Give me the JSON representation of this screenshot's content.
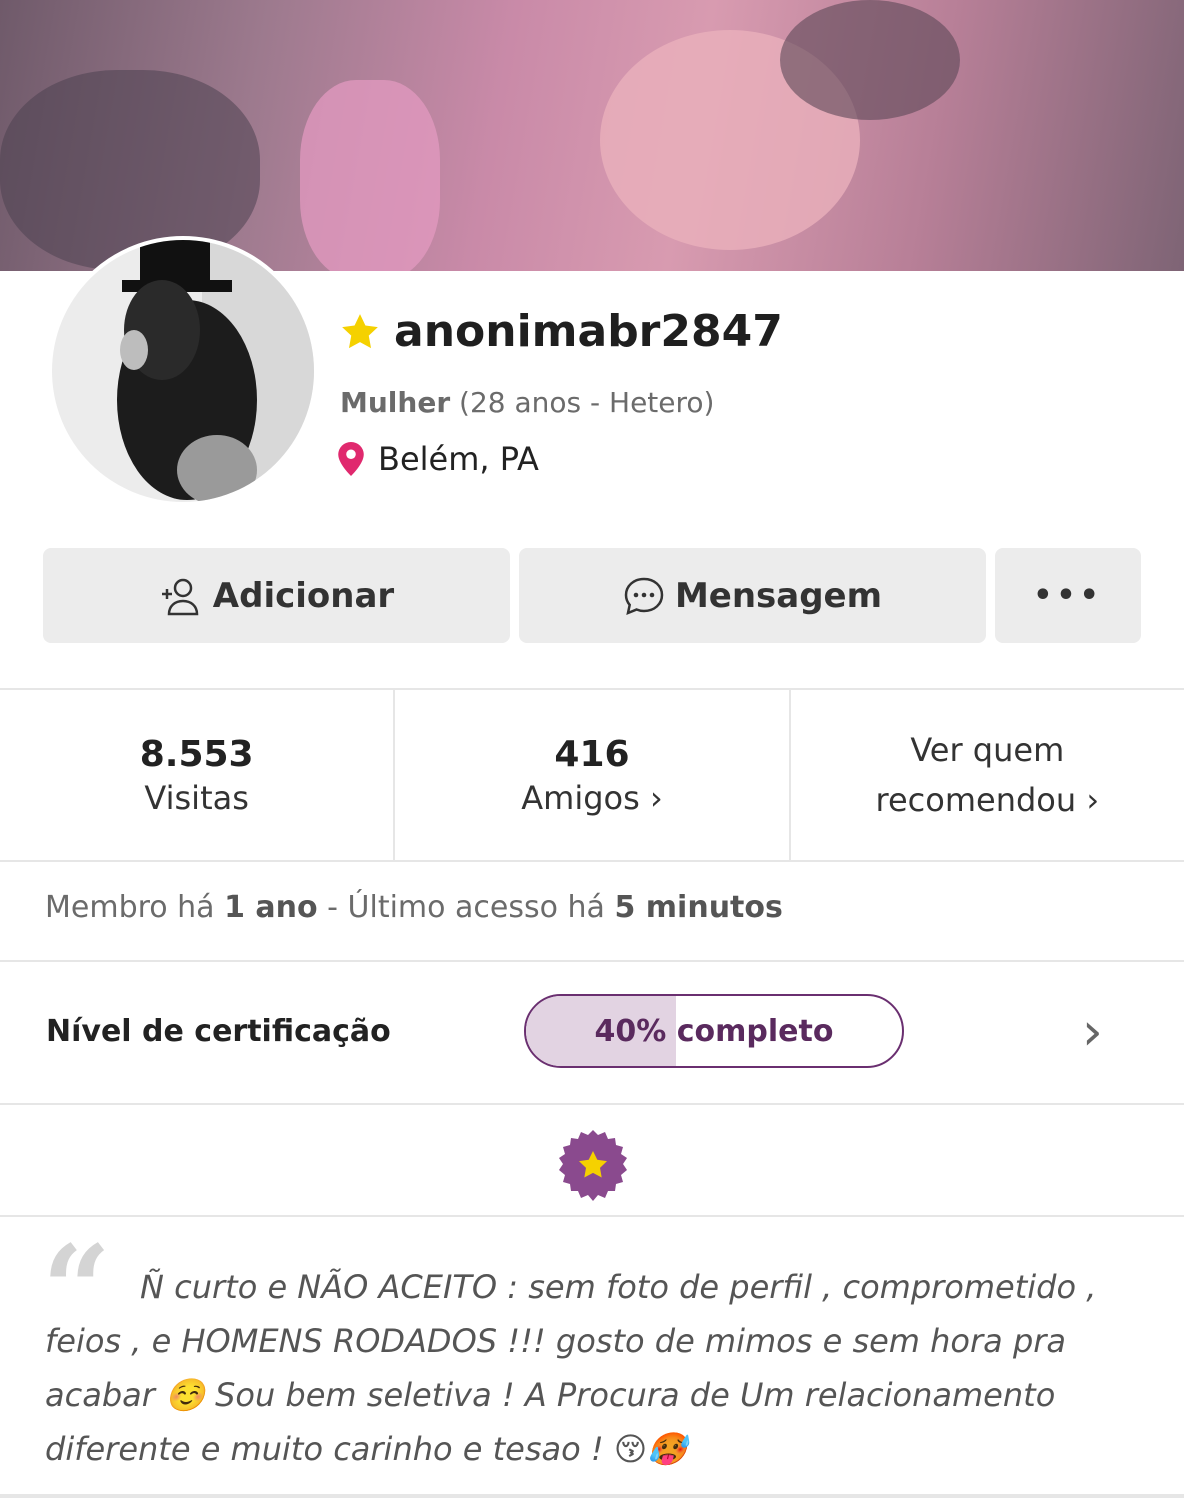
{
  "profile": {
    "username": "anonimabr2847",
    "gender": "Mulher",
    "age_orientation": "(28 anos - Hetero)",
    "location": "Belém, PA"
  },
  "actions": {
    "add_label": "Adicionar",
    "message_label": "Mensagem",
    "more_label": "•••"
  },
  "stats": {
    "visits_count": "8.553",
    "visits_label": "Visitas",
    "friends_count": "416",
    "friends_label": "Amigos ›",
    "recommend_line1": "Ver quem",
    "recommend_line2": "recomendou ›"
  },
  "member": {
    "prefix": "Membro há ",
    "since": "1 ano",
    "middle": " - Último acesso há ",
    "last_access": "5 minutos"
  },
  "certification": {
    "label": "Nível de certificação",
    "progress_text": "40% completo",
    "progress_fraction": 0.4
  },
  "bio": {
    "text": "Ñ curto e NÃO ACEITO : sem foto de perfil , comprometido , feios , e HOMENS RODADOS !!! gosto de mimos e sem hora pra acabar ☺️ Sou bem seletiva ! A Procura de Um relacionamento diferente e muito carinho e tesao ! 😚🥵"
  },
  "colors": {
    "accent_purple": "#6a2f70",
    "location_pin": "#e0296e",
    "star_yellow": "#f5d100"
  }
}
